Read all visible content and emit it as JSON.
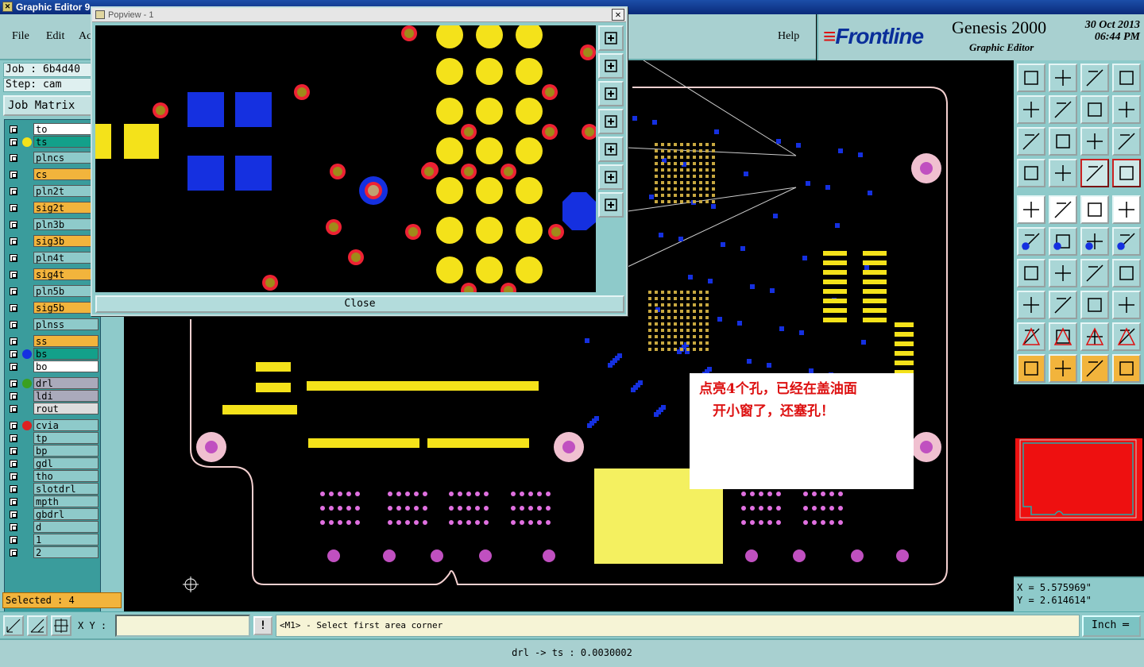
{
  "window": {
    "title": "Graphic Editor 9."
  },
  "menu": {
    "file": "File",
    "edit": "Edit",
    "actions": "Ac",
    "help": "Help"
  },
  "brand": {
    "logo": "Frontline",
    "product": "Genesis 2000",
    "subtitle": "Graphic Editor",
    "date": "30 Oct 2013",
    "time": "06:44 PM"
  },
  "job": {
    "job_label": "Job : 6b4d40",
    "step_label": "Step: cam",
    "matrix_button": "Job Matrix"
  },
  "layers": [
    {
      "name": "to",
      "color": "#ffffff",
      "dot": ""
    },
    {
      "name": "ts",
      "color": "#13a08a",
      "dot": "#f4e21a"
    },
    {
      "name": "plncs",
      "color": "#8ecaca",
      "dot": ""
    },
    {
      "name": "cs",
      "color": "#f2b43c",
      "dot": ""
    },
    {
      "name": "pln2t",
      "color": "#8ecaca",
      "dot": ""
    },
    {
      "name": "sig2t",
      "color": "#f2b43c",
      "dot": ""
    },
    {
      "name": "pln3b",
      "color": "#8ecaca",
      "dot": ""
    },
    {
      "name": "sig3b",
      "color": "#f2b43c",
      "dot": ""
    },
    {
      "name": "pln4t",
      "color": "#8ecaca",
      "dot": ""
    },
    {
      "name": "sig4t",
      "color": "#f2b43c",
      "dot": ""
    },
    {
      "name": "pln5b",
      "color": "#8ecaca",
      "dot": ""
    },
    {
      "name": "sig5b",
      "color": "#f2b43c",
      "dot": ""
    },
    {
      "name": "plnss",
      "color": "#8ecaca",
      "dot": ""
    },
    {
      "name": "ss",
      "color": "#f2b43c",
      "dot": ""
    },
    {
      "name": "bs",
      "color": "#13a08a",
      "dot": "#1530e0"
    },
    {
      "name": "bo",
      "color": "#ffffff",
      "dot": ""
    },
    {
      "name": "drl",
      "color": "#aab",
      "dot": "#3aa020"
    },
    {
      "name": "ldi",
      "color": "#aab",
      "dot": ""
    },
    {
      "name": "rout",
      "color": "#ddd",
      "dot": ""
    },
    {
      "name": "cvia",
      "color": "#8ecaca",
      "dot": "#d22"
    },
    {
      "name": "tp",
      "color": "#8ecaca",
      "dot": ""
    },
    {
      "name": "bp",
      "color": "#8ecaca",
      "dot": ""
    },
    {
      "name": "gdl",
      "color": "#8ecaca",
      "dot": ""
    },
    {
      "name": "tho",
      "color": "#8ecaca",
      "dot": ""
    },
    {
      "name": "slotdrl",
      "color": "#8ecaca",
      "dot": ""
    },
    {
      "name": "mpth",
      "color": "#8ecaca",
      "dot": ""
    },
    {
      "name": "gbdrl",
      "color": "#8ecaca",
      "dot": ""
    },
    {
      "name": "d",
      "color": "#8ecaca",
      "dot": ""
    },
    {
      "name": "1",
      "color": "#8ecaca",
      "dot": ""
    },
    {
      "name": "2",
      "color": "#8ecaca",
      "dot": ""
    }
  ],
  "selected": "Selected : 4",
  "popview": {
    "title": "Popview - 1",
    "close": "Close",
    "close_x": "✕"
  },
  "annotation": "点亮4个孔，已经在盖油面\n　开小窗了，还塞孔！",
  "coords": {
    "x": "X = 5.575969\"",
    "y": "Y = 2.614614\""
  },
  "command": {
    "xy_label": "X Y :",
    "xy_value": "",
    "excl": "!",
    "prompt": "<M1> - Select first area corner",
    "unit": "Inch ═"
  },
  "status": "drl -> ts : 0.0030002",
  "colors": {
    "pad": "#f4e21a",
    "via": "#1530e0",
    "drill": "#e23",
    "copper_violet": "#c050c0",
    "accent": "#8ecaca"
  }
}
